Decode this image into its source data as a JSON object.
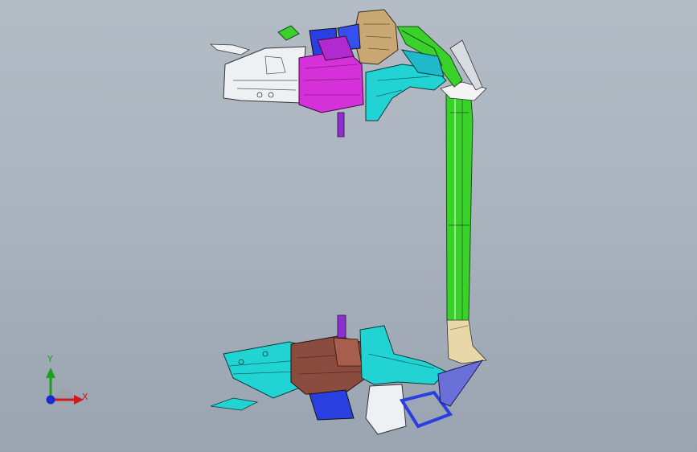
{
  "viewport": {
    "background_top": "#b4bcc6",
    "background_bottom": "#9aa4b1"
  },
  "model": {
    "description_icon": "car-body-side-frame-assembly",
    "colors": {
      "green": "#39d12a",
      "cyan": "#22d3d3",
      "magenta": "#d431d8",
      "brown": "#8a4c3e",
      "blue": "#2a3fe0",
      "white": "#eef1f4",
      "tan": "#c9a874",
      "cream": "#e8d7a8",
      "violet": "#8c2ed0"
    }
  },
  "triad": {
    "y_label": "Y",
    "x_label": "X",
    "y_color": "#1aa01a",
    "x_color": "#d01a1a",
    "z_color": "#1a2ad0"
  }
}
